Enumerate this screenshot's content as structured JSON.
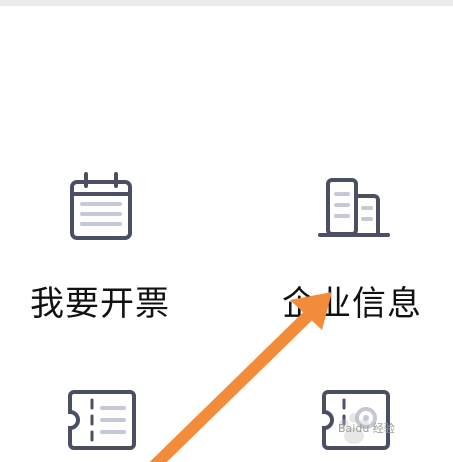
{
  "top_bar": {
    "color": "#ebebee"
  },
  "grid": {
    "items": [
      {
        "id": "invoice",
        "label": "我要开票",
        "icon": "calendar-icon"
      },
      {
        "id": "company",
        "label": "企业信息",
        "icon": "building-icon"
      },
      {
        "id": "ticket-list",
        "label": "",
        "icon": "ticket-list-icon"
      },
      {
        "id": "ticket-gear",
        "label": "",
        "icon": "ticket-settings-icon"
      }
    ]
  },
  "overlay": {
    "arrow_color": "#f28c3a",
    "watermark": "Baidu 经验"
  },
  "colors": {
    "icon_stroke": "#4a4f63",
    "icon_fill": "#c5c8d6",
    "label": "#111111"
  }
}
